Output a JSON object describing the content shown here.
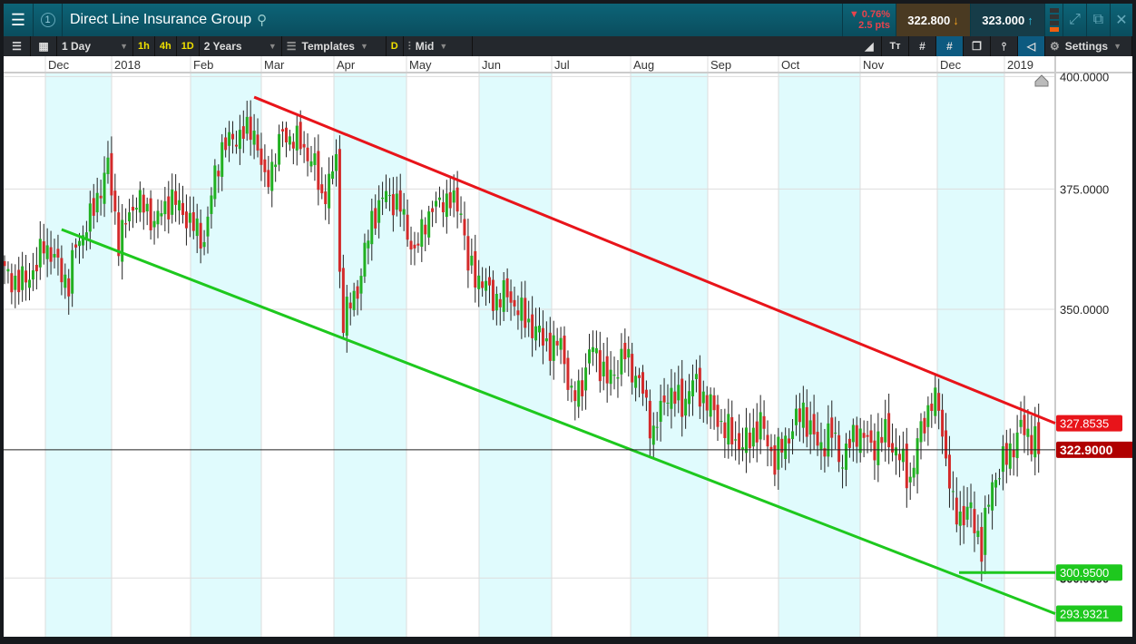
{
  "header": {
    "title": "Direct Line Insurance Group",
    "change_pct": "▼ 0.76%",
    "change_pts": "2.5 pts",
    "sell": "322.800",
    "buy": "323.000",
    "tab_number": "1"
  },
  "toolbar": {
    "interval": "1 Day",
    "quick": [
      "1h",
      "4h",
      "1D"
    ],
    "range": "2 Years",
    "templates": "Templates",
    "d": "D",
    "price_type": "Mid",
    "settings": "Settings"
  },
  "colors": {
    "up": "#22b022",
    "down": "#d32a2a",
    "red_line": "#e8141a",
    "green_line": "#1ec81e",
    "band": "#e0fbfd"
  },
  "chart_data": {
    "type": "candlestick",
    "scale": "log",
    "months": [
      "Dec",
      "2018",
      "Feb",
      "Mar",
      "Apr",
      "May",
      "Jun",
      "Jul",
      "Aug",
      "Sep",
      "Oct",
      "Nov",
      "Dec",
      "2019"
    ],
    "y_ticks": [
      "400.0000",
      "375.0000",
      "350.0000",
      "300.0000"
    ],
    "y_tick_values": [
      400,
      375,
      350,
      300
    ],
    "ylim": [
      289,
      401
    ],
    "close_path": [
      [
        0,
        357.5
      ],
      [
        4,
        355
      ],
      [
        9,
        358.5
      ],
      [
        11,
        363.8
      ],
      [
        18,
        355
      ],
      [
        20,
        363
      ],
      [
        24,
        368.6
      ],
      [
        29,
        380
      ],
      [
        32,
        364
      ],
      [
        37,
        373
      ],
      [
        42,
        368
      ],
      [
        47,
        373
      ],
      [
        52,
        368
      ],
      [
        56,
        364
      ],
      [
        59,
        378
      ],
      [
        61,
        384
      ],
      [
        66,
        387
      ],
      [
        70,
        388
      ],
      [
        73,
        376
      ],
      [
        75,
        380
      ],
      [
        78,
        387
      ],
      [
        83,
        385
      ],
      [
        87,
        380
      ],
      [
        89,
        373
      ],
      [
        92,
        378
      ],
      [
        93,
        383
      ],
      [
        94,
        357.5
      ],
      [
        95,
        348
      ],
      [
        99,
        354
      ],
      [
        103,
        368.6
      ],
      [
        107,
        374
      ],
      [
        111,
        371
      ],
      [
        115,
        361
      ],
      [
        118,
        368.6
      ],
      [
        123,
        373
      ],
      [
        128,
        371
      ],
      [
        130,
        358.5
      ],
      [
        134,
        355.6
      ],
      [
        137,
        352
      ],
      [
        141,
        353
      ],
      [
        145,
        349
      ],
      [
        149,
        345.6
      ],
      [
        154,
        342
      ],
      [
        156,
        344
      ],
      [
        159,
        332
      ],
      [
        162,
        335.7
      ],
      [
        165,
        342.9
      ],
      [
        169,
        335.7
      ],
      [
        174,
        341
      ],
      [
        178,
        335.7
      ],
      [
        182,
        326
      ],
      [
        186,
        334
      ],
      [
        190,
        331.3
      ],
      [
        193,
        335.7
      ],
      [
        197,
        332
      ],
      [
        202,
        326.8
      ],
      [
        207,
        323.4
      ],
      [
        212,
        327.8
      ],
      [
        216,
        320.8
      ],
      [
        220,
        325.9
      ],
      [
        224,
        330.3
      ],
      [
        228,
        323.4
      ],
      [
        232,
        325.9
      ],
      [
        235,
        320.8
      ],
      [
        239,
        326.8
      ],
      [
        243,
        323.4
      ],
      [
        247,
        325.9
      ],
      [
        251,
        321.5
      ],
      [
        254,
        317.4
      ],
      [
        257,
        326.8
      ],
      [
        260,
        332
      ],
      [
        262,
        331
      ],
      [
        264,
        321.5
      ],
      [
        266,
        312
      ],
      [
        268,
        311
      ],
      [
        271,
        311.5
      ],
      [
        274,
        305.5
      ],
      [
        277,
        317
      ],
      [
        281,
        321.5
      ],
      [
        285,
        326.8
      ],
      [
        289,
        324.9
      ],
      [
        290,
        322.3
      ]
    ],
    "resistance_line": {
      "start": [
        70,
        395.3
      ],
      "end_label": "327.8535",
      "end": 327.8535
    },
    "support_line": {
      "start": [
        16,
        366.4
      ],
      "end_label": "293.9321",
      "end": 293.9321
    },
    "support_horizontal": {
      "label": "300.9500",
      "value": 300.95
    },
    "current_price": {
      "label": "322.9000",
      "value": 322.9
    }
  }
}
